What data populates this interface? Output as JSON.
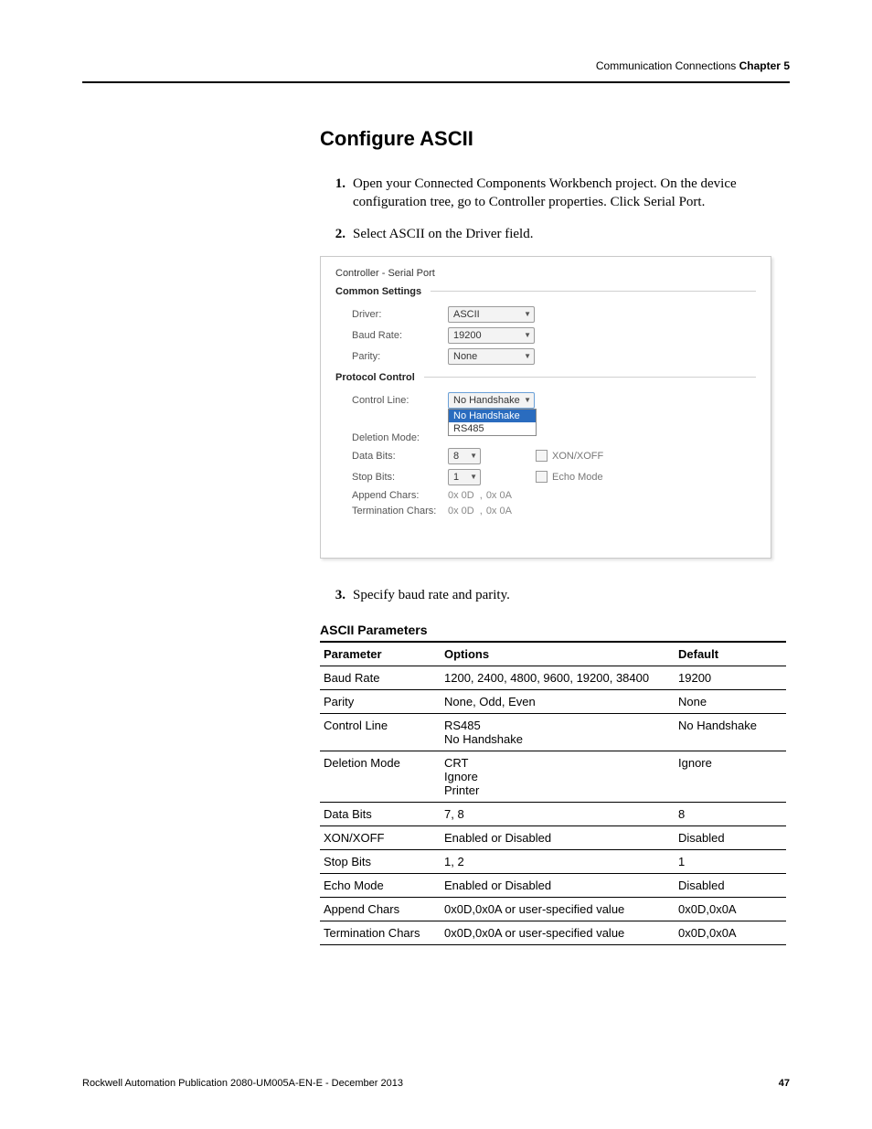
{
  "header": {
    "section": "Communication Connections",
    "chapter": "Chapter 5"
  },
  "title": "Configure ASCII",
  "steps": {
    "s1": {
      "num": "1.",
      "text": "Open your Connected Components Workbench project. On the device configuration tree, go to Controller properties. Click Serial Port."
    },
    "s2": {
      "num": "2.",
      "text": "Select ASCII on the Driver field."
    },
    "s3": {
      "num": "3.",
      "text": "Specify baud rate and parity."
    }
  },
  "shot": {
    "title": "Controller - Serial Port",
    "group_common": "Common Settings",
    "group_protocol": "Protocol Control",
    "labels": {
      "driver": "Driver:",
      "baud": "Baud Rate:",
      "parity": "Parity:",
      "control_line": "Control Line:",
      "deletion_mode": "Deletion Mode:",
      "data_bits": "Data Bits:",
      "stop_bits": "Stop Bits:",
      "append": "Append Chars:",
      "term": "Termination Chars:"
    },
    "values": {
      "driver": "ASCII",
      "baud": "19200",
      "parity": "None",
      "control_line": "No Handshake",
      "data_bits": "8",
      "stop_bits": "1",
      "append1": "0x 0D",
      "append2": "0x 0A",
      "term1": "0x 0D",
      "term2": "0x 0A"
    },
    "dropdown": {
      "opt1": "No Handshake",
      "opt2": "RS485"
    },
    "checkboxes": {
      "xon": "XON/XOFF",
      "echo": "Echo Mode"
    },
    "comma": ","
  },
  "table": {
    "title": "ASCII Parameters",
    "head": {
      "c1": "Parameter",
      "c2": "Options",
      "c3": "Default"
    },
    "rows": [
      {
        "p": "Baud Rate",
        "o": "1200, 2400, 4800, 9600, 19200, 38400",
        "d": "19200"
      },
      {
        "p": "Parity",
        "o": "None, Odd, Even",
        "d": "None"
      },
      {
        "p": "Control Line",
        "o": "RS485\nNo Handshake",
        "d": "No Handshake"
      },
      {
        "p": "Deletion Mode",
        "o": "CRT\nIgnore\nPrinter",
        "d": "Ignore"
      },
      {
        "p": "Data Bits",
        "o": "7, 8",
        "d": "8"
      },
      {
        "p": "XON/XOFF",
        "o": "Enabled or Disabled",
        "d": "Disabled"
      },
      {
        "p": "Stop Bits",
        "o": "1, 2",
        "d": "1"
      },
      {
        "p": "Echo Mode",
        "o": "Enabled or Disabled",
        "d": "Disabled"
      },
      {
        "p": "Append Chars",
        "o": "0x0D,0x0A or user-specified value",
        "d": "0x0D,0x0A"
      },
      {
        "p": "Termination Chars",
        "o": "0x0D,0x0A or user-specified value",
        "d": "0x0D,0x0A"
      }
    ]
  },
  "footer": {
    "pub": "Rockwell Automation Publication 2080-UM005A-EN-E - December 2013",
    "page": "47"
  }
}
